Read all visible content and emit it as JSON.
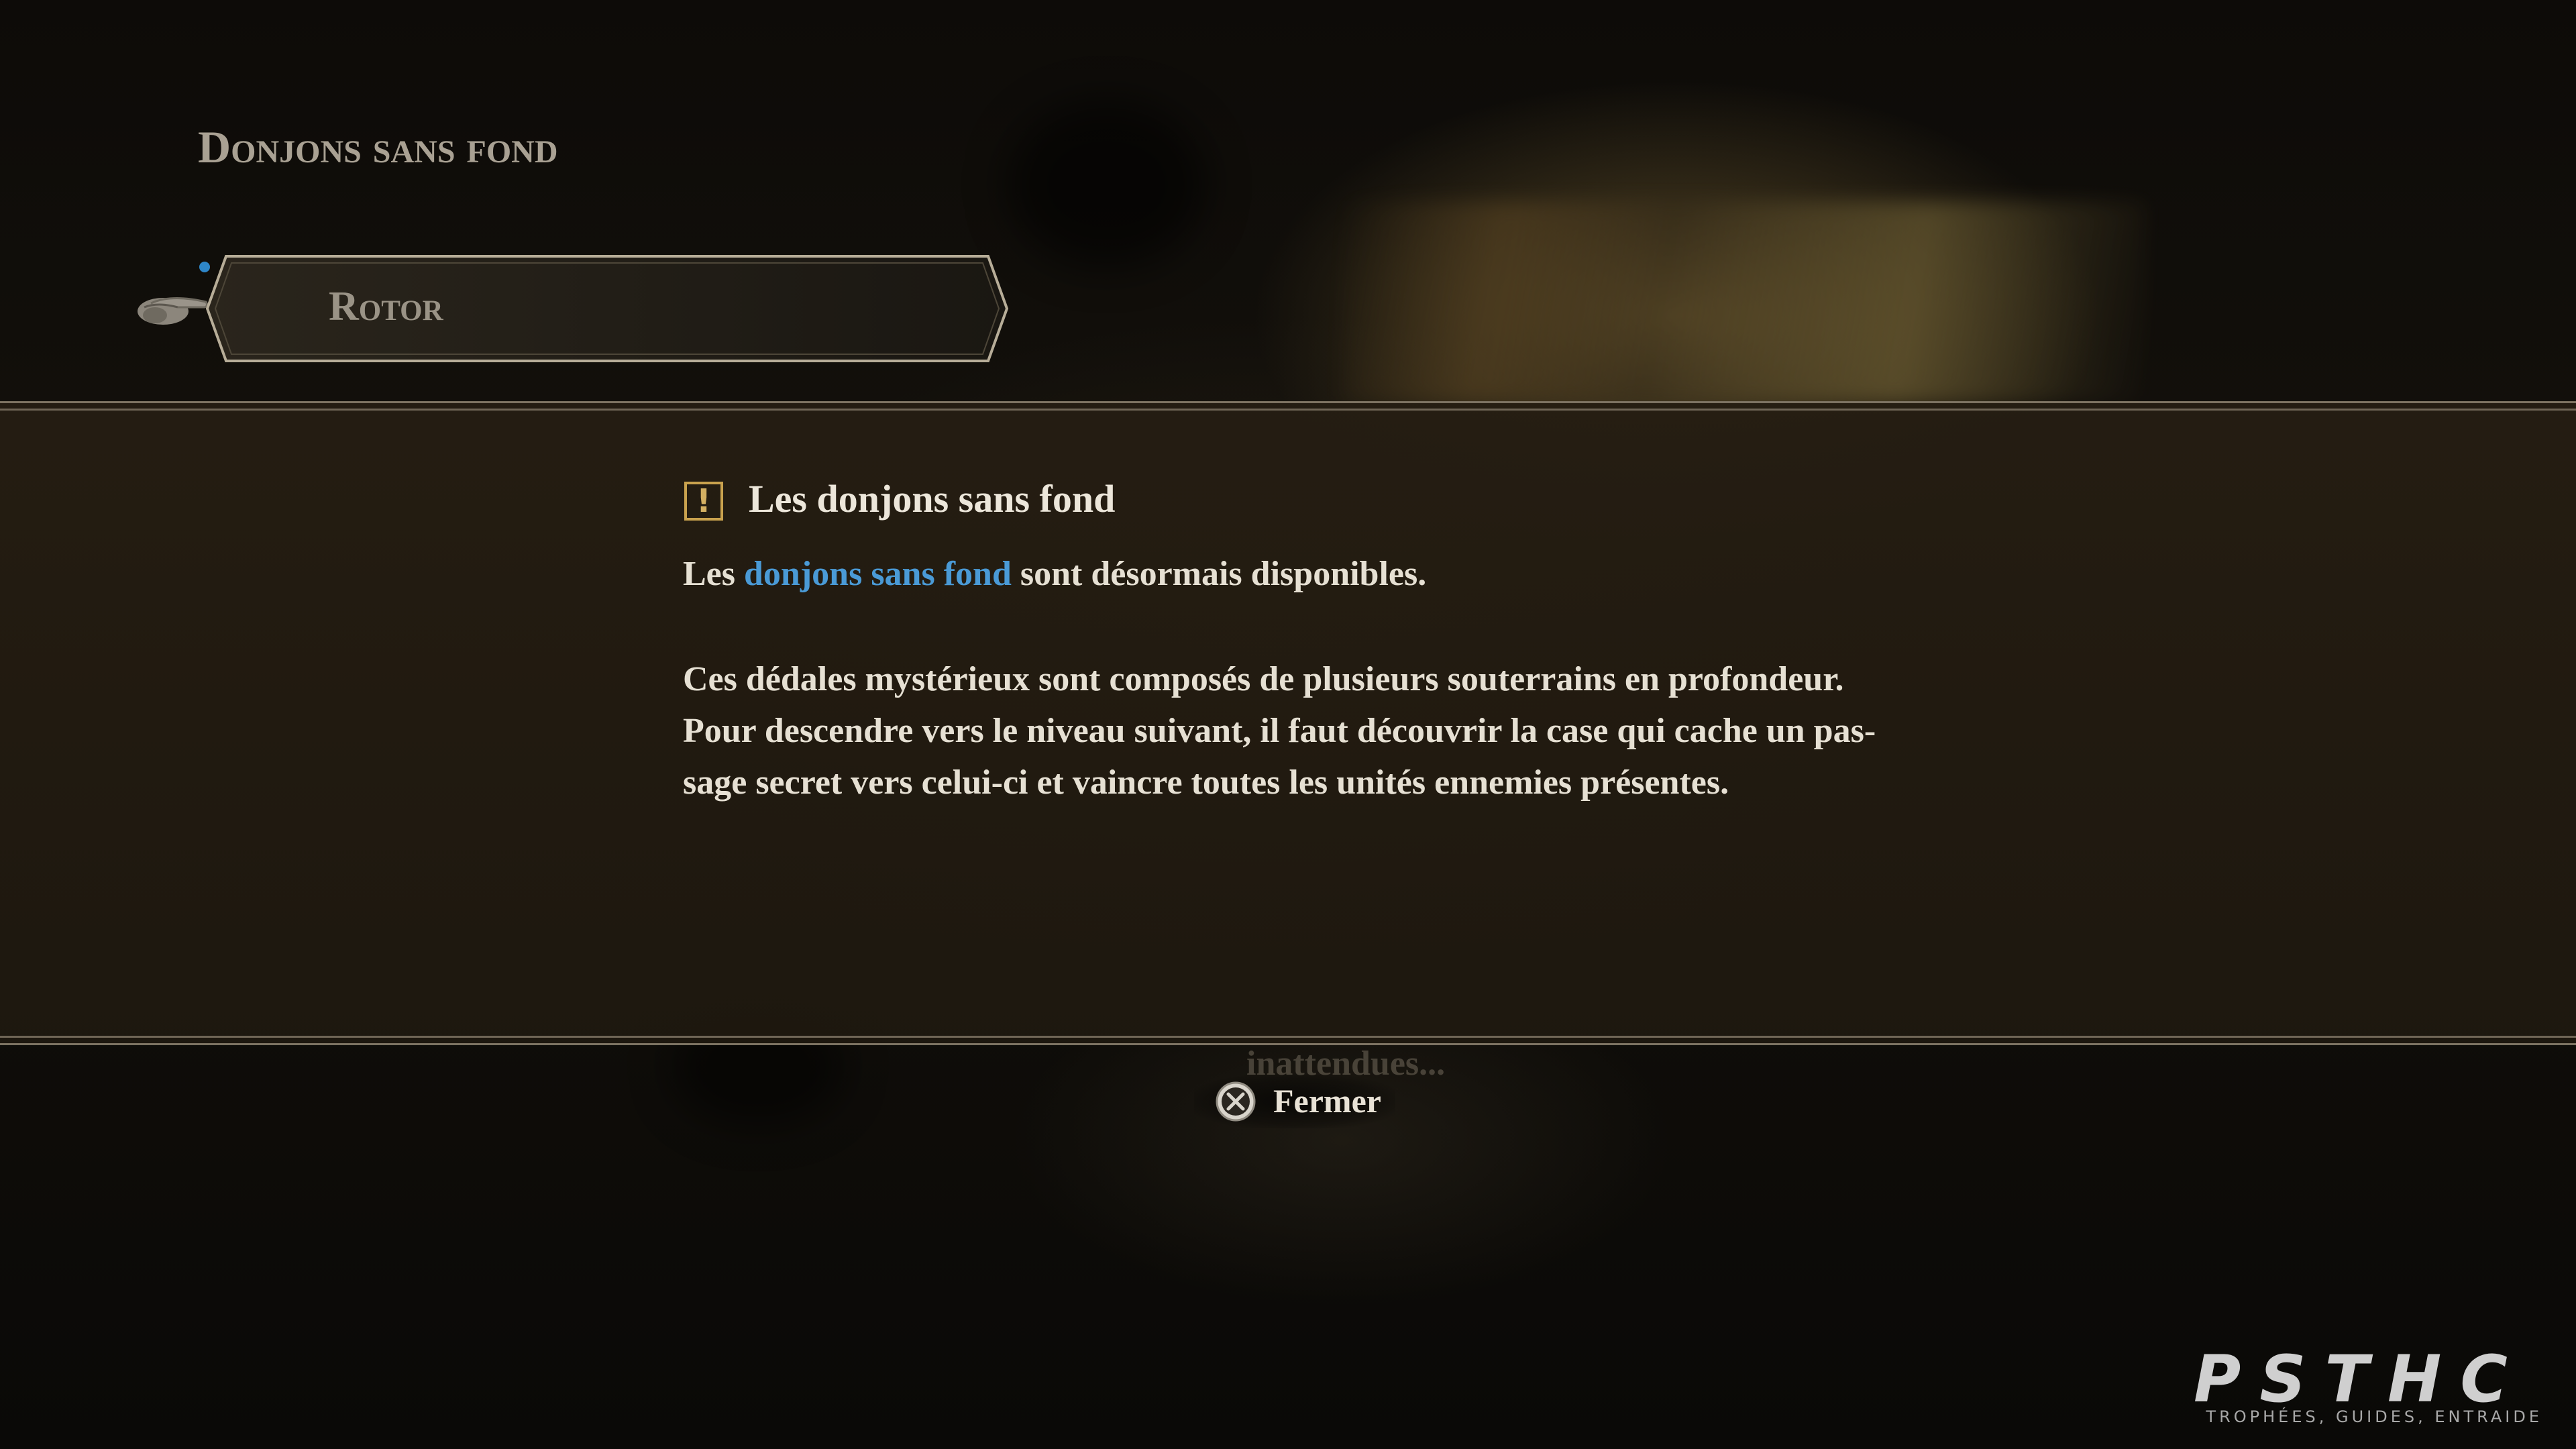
{
  "screen": {
    "section_title": "Donjons sans fond",
    "menu": {
      "selected_item": "Rotor",
      "pointer_icon": "pointing-hand-icon",
      "accent_dot_color": "#2e86c8"
    }
  },
  "notice": {
    "icon": "warning-icon",
    "title": "Les donjons sans fond",
    "line1": {
      "prefix": "Les",
      "link": "donjons sans fond",
      "suffix": "sont désormais disponibles."
    },
    "paragraph": [
      "Ces dédales mystérieux sont composés de plusieurs souterrains en profondeur.",
      "Pour descendre vers le niveau suivant, il faut découvrir la case qui cache un pas-",
      "sage secret vers celui-ci et vaincre toutes les unités ennemies présentes."
    ],
    "link_color": "#4a9ad6"
  },
  "background_text": "inattendues...",
  "close_prompt": {
    "button_icon": "cross-button-icon",
    "label": "Fermer"
  },
  "watermark": {
    "logo": "PSTHC",
    "tagline": "TROPHÉES, GUIDES, ENTRAIDE"
  }
}
